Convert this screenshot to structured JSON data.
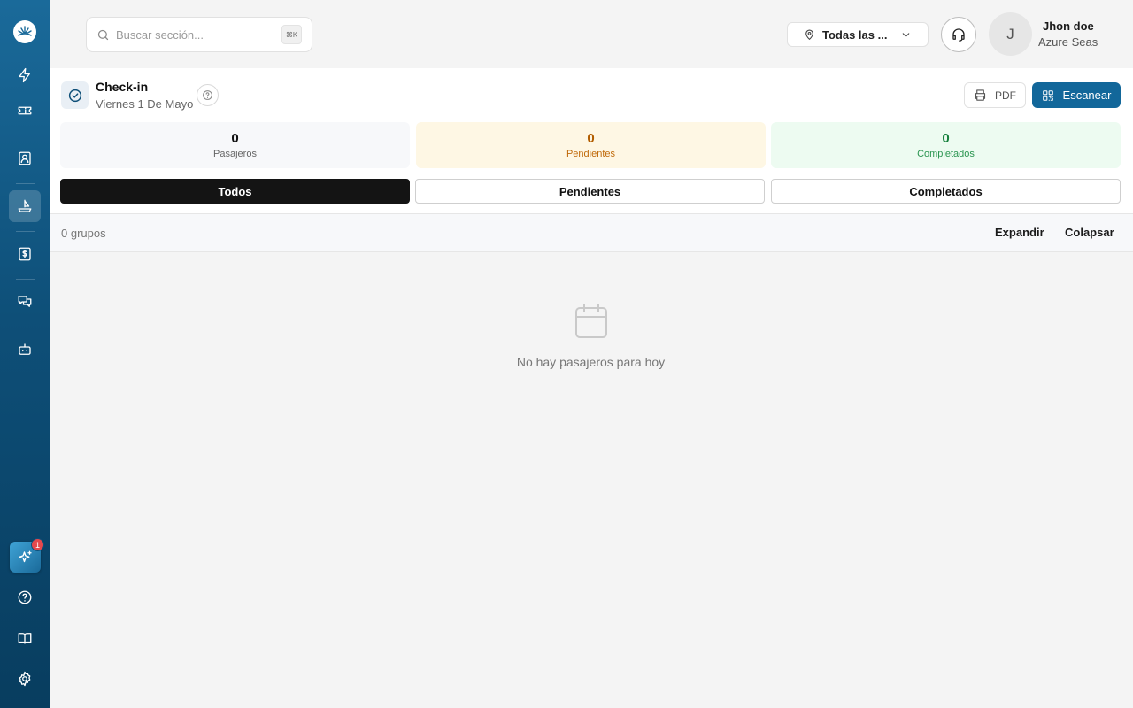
{
  "sidebar": {
    "logo_icon": "sea-logo-icon",
    "items": [
      {
        "name": "bolt-icon"
      },
      {
        "name": "ticket-icon"
      },
      {
        "name": "contact-icon"
      },
      {
        "name": "ship-icon",
        "active": true
      },
      {
        "name": "dollar-icon"
      },
      {
        "name": "chat-icon"
      },
      {
        "name": "bot-icon"
      }
    ],
    "ai_badge": "1",
    "bottom_items": [
      {
        "name": "help-icon"
      },
      {
        "name": "book-icon"
      },
      {
        "name": "gear-icon"
      }
    ]
  },
  "header": {
    "search_placeholder": "Buscar sección...",
    "search_shortcut": "⌘K",
    "location_label": "Todas las ...",
    "avatar_initial": "J",
    "user_name": "Jhon doe",
    "user_org": "Azure Seas"
  },
  "page": {
    "title": "Check-in",
    "date": "Viernes 1 De Mayo",
    "pdf_label": "PDF",
    "scan_label": "Escanear",
    "stats": {
      "total": {
        "value": "0",
        "label": "Pasajeros"
      },
      "pending": {
        "value": "0",
        "label": "Pendientes"
      },
      "done": {
        "value": "0",
        "label": "Completados"
      }
    },
    "tabs": [
      {
        "label": "Todos",
        "active": true
      },
      {
        "label": "Pendientes",
        "active": false
      },
      {
        "label": "Completados",
        "active": false
      }
    ],
    "group_count": "0 grupos",
    "expand_label": "Expandir",
    "collapse_label": "Colapsar",
    "empty_message": "No hay pasajeros para hoy"
  },
  "colors": {
    "sidebar_top": "#1a6a9a",
    "sidebar_bottom": "#083d5f",
    "primary": "#12679a",
    "pending": "#b25d00",
    "done": "#16803d"
  }
}
